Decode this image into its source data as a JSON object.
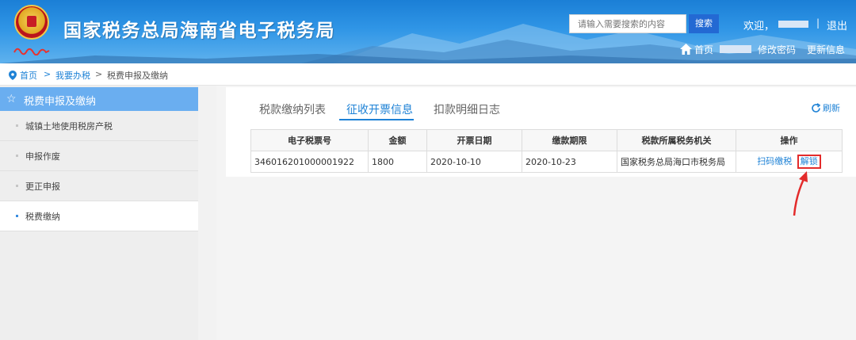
{
  "header": {
    "site_title": "国家税务总局海南省电子税务局",
    "search_placeholder": "请输入需要搜索的内容",
    "search_button": "搜索",
    "welcome": "欢迎，",
    "separator": "|",
    "logout": "退出",
    "home": "首页",
    "change_password": "修改密码",
    "update_info": "更新信息"
  },
  "breadcrumb": {
    "home": "首页",
    "sep": ">",
    "tax": "我要办税",
    "current": "税费申报及缴纳"
  },
  "sidebar": {
    "title": "税费申报及缴纳",
    "items": [
      {
        "label": "城镇土地使用税房产税"
      },
      {
        "label": "申报作废"
      },
      {
        "label": "更正申报"
      },
      {
        "label": "税费缴纳"
      }
    ]
  },
  "main": {
    "tabs": [
      {
        "label": "税款缴纳列表"
      },
      {
        "label": "征收开票信息"
      },
      {
        "label": "扣款明细日志"
      }
    ],
    "refresh": "刷新",
    "table": {
      "headers": [
        "电子税票号",
        "金额",
        "开票日期",
        "缴款期限",
        "税款所属税务机关",
        "操作"
      ],
      "rows": [
        {
          "ticket_no": "346016201000001922",
          "amount": "1800",
          "issue_date": "2020-10-10",
          "deadline": "2020-10-23",
          "authority": "国家税务总局海口市税务局",
          "op_scan_pay": "扫码缴税",
          "op_unlock": "解锁"
        }
      ]
    }
  },
  "colors": {
    "header_blue": "#1b7fd6",
    "link_blue": "#1e82d6",
    "sidebar_active": "#6aaef0",
    "highlight_red": "#e32b2b"
  }
}
